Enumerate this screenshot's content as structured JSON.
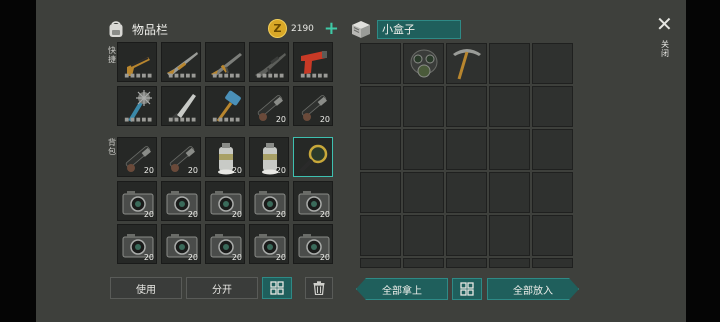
{
  "inventory": {
    "title": "物品栏",
    "coins": "2190",
    "quick_label": "快捷",
    "bag_label": "背包",
    "rows": [
      [
        {
          "icon": "revolver",
          "qty": ""
        },
        {
          "icon": "shotgun",
          "qty": ""
        },
        {
          "icon": "assault-rifle",
          "qty": ""
        },
        {
          "icon": "rifle",
          "qty": ""
        },
        {
          "icon": "flare-gun",
          "qty": ""
        }
      ],
      [
        {
          "icon": "spiked-club",
          "qty": ""
        },
        {
          "icon": "machete",
          "qty": ""
        },
        {
          "icon": "sledgehammer",
          "qty": ""
        },
        {
          "icon": "suppressor",
          "qty": "20"
        },
        {
          "icon": "suppressor",
          "qty": "20"
        }
      ],
      [
        {
          "icon": "suppressor",
          "qty": "20"
        },
        {
          "icon": "suppressor",
          "qty": "20"
        },
        {
          "icon": "spray-can",
          "qty": "20"
        },
        {
          "icon": "spray-can",
          "qty": "20"
        },
        {
          "icon": "magnifier",
          "qty": ""
        }
      ],
      [
        {
          "icon": "camera",
          "qty": "20"
        },
        {
          "icon": "camera",
          "qty": "20"
        },
        {
          "icon": "camera",
          "qty": "20"
        },
        {
          "icon": "camera",
          "qty": "20"
        },
        {
          "icon": "camera",
          "qty": "20"
        }
      ],
      [
        {
          "icon": "camera",
          "qty": "20"
        },
        {
          "icon": "camera",
          "qty": "20"
        },
        {
          "icon": "camera",
          "qty": "20"
        },
        {
          "icon": "camera",
          "qty": "20"
        },
        {
          "icon": "camera",
          "qty": "20"
        }
      ]
    ],
    "use_label": "使用",
    "split_label": "分开"
  },
  "box": {
    "title": "小盒子",
    "items": [
      {
        "icon": "gas-mask"
      },
      {
        "icon": "pickaxe"
      }
    ],
    "take_all_label": "全部拿上",
    "put_all_label": "全部放入"
  },
  "close_label": "关闭"
}
